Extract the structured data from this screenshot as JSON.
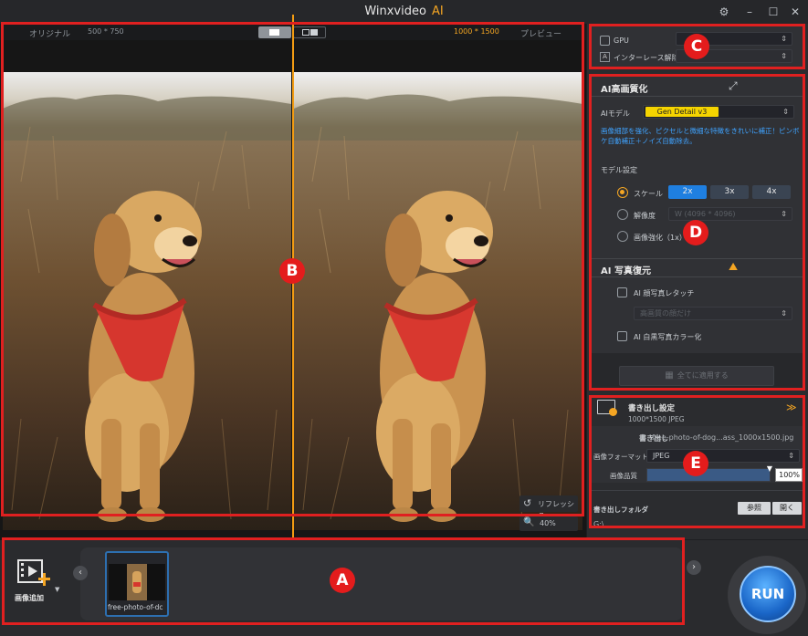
{
  "app": {
    "title_main": "Winxvideo",
    "title_ai": "AI"
  },
  "preview": {
    "left_label": "オリジナル",
    "left_res": "500 * 750",
    "right_res": "1000 * 1500",
    "right_label": "プレビュー",
    "refresh_label": "リフレッシュ",
    "zoom": "40%"
  },
  "gpu": {
    "gpu_label": "GPU",
    "deinterlace_label": "インターレース解除"
  },
  "ai_enhance": {
    "header": "AI高画質化",
    "model_label": "AIモデル",
    "model_value": "Gen Detail v3",
    "description": "画像細部を強化、ピクセルと微細な特徴をきれいに補正！ピンボケ自動補正＋ノイズ自動除去。",
    "settings_label": "モデル設定",
    "scale_label": "スケール",
    "scale_options": [
      "2x",
      "3x",
      "4x"
    ],
    "resolution_label": "解像度",
    "resolution_value": "W (4096 * 4096)",
    "enhance_label": "画像強化（1x）"
  },
  "ai_restore": {
    "header": "AI 写真復元",
    "face_label": "AI 顔写真レタッチ",
    "face_select": "高画質の顔だけ",
    "colorize_label": "AI 白黒写真カラー化",
    "apply_all": "全てに適用する"
  },
  "export": {
    "header": "書き出し設定",
    "sub": "1000*1500  JPEG",
    "output_label": "書き出し",
    "output_name": "free-photo-of-dog...ass_1000x1500.jpg",
    "format_label": "画像フォーマット",
    "format_value": "JPEG",
    "quality_label": "画像品質",
    "quality_value": "100%",
    "quality_fraction": 1.0,
    "folder_label": "書き出しフォルダ",
    "browse": "参照",
    "open": "開く",
    "folder_path": "G:\\"
  },
  "tray": {
    "add_label": "画像追加",
    "thumb_label": "free-photo-of-dc",
    "run_label": "RUN"
  },
  "annotations": {
    "a": "A",
    "b": "B",
    "c": "C",
    "d": "D",
    "e": "E"
  }
}
